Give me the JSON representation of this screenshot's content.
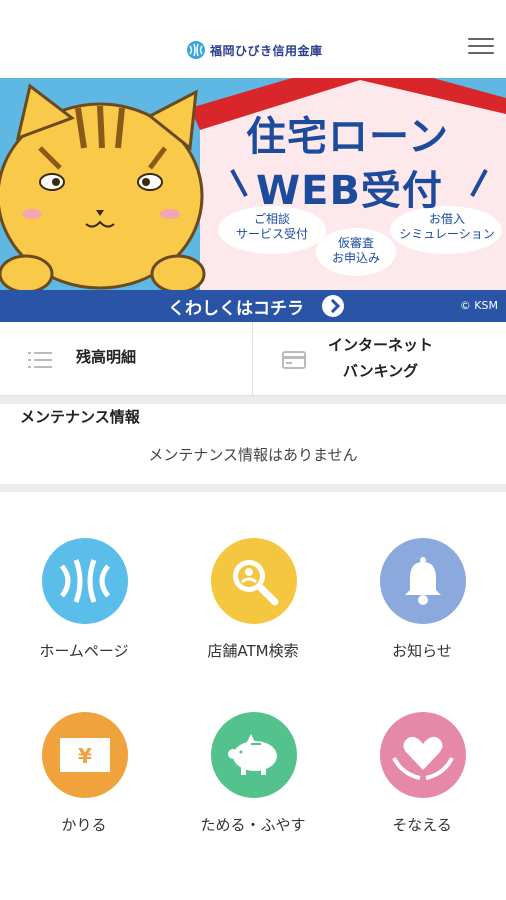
{
  "header": {
    "logo_text": "福岡ひびき信用金庫",
    "logo_icon": "hibiki-logo-icon",
    "menu_icon": "hamburger-menu-icon"
  },
  "banner": {
    "title_line1": "住宅ローン",
    "title_line2": "WEB受付",
    "bubble1": "ご相談\nサービス受付",
    "bubble2": "仮審査\nお申込み",
    "bubble3": "お借入\nシミュレーション",
    "cta": "くわしくはコチラ",
    "copyright": "© KSM"
  },
  "quick": {
    "balance_label": "残高明細",
    "netbanking_line1": "インターネット",
    "netbanking_line2": "バンキング"
  },
  "maintenance": {
    "title": "メンテナンス情報",
    "message": "メンテナンス情報はありません"
  },
  "menu": [
    {
      "label": "ホームページ",
      "icon": "hibiki-logo-icon",
      "color": "#5bbde9"
    },
    {
      "label": "店舗ATM検索",
      "icon": "search-icon",
      "color": "#f5c640"
    },
    {
      "label": "お知らせ",
      "icon": "bell-icon",
      "color": "#8ba9dd"
    },
    {
      "label": "かりる",
      "icon": "yen-card-icon",
      "color": "#f0a23c"
    },
    {
      "label": "ためる・ふやす",
      "icon": "piggy-bank-icon",
      "color": "#54c28d"
    },
    {
      "label": "そなえる",
      "icon": "heart-hands-icon",
      "color": "#e689a8"
    }
  ],
  "colors": {
    "brand_blue": "#2a54a6",
    "banner_sky": "#5fb8e4",
    "roof_red": "#d9262b"
  }
}
